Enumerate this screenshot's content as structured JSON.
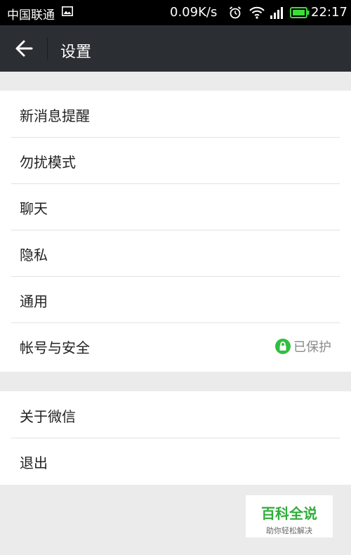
{
  "status_bar": {
    "carrier": "中国联通",
    "speed": "0.09K/s",
    "time": "22:17",
    "battery_color": "#3ddc3a"
  },
  "app_bar": {
    "title": "设置",
    "background": "#2b2e33"
  },
  "settings": {
    "group1": [
      {
        "label": "新消息提醒"
      },
      {
        "label": "勿扰模式"
      },
      {
        "label": "聊天"
      },
      {
        "label": "隐私"
      },
      {
        "label": "通用"
      },
      {
        "label": "帐号与安全",
        "status": "已保护",
        "status_icon": "lock-icon",
        "status_icon_color": "#2fbf40"
      }
    ],
    "group2": [
      {
        "label": "关于微信"
      },
      {
        "label": "退出"
      }
    ]
  },
  "watermark": {
    "title": "百科全说",
    "subtitle": "助你轻松解决",
    "color": "#2fae3a"
  }
}
